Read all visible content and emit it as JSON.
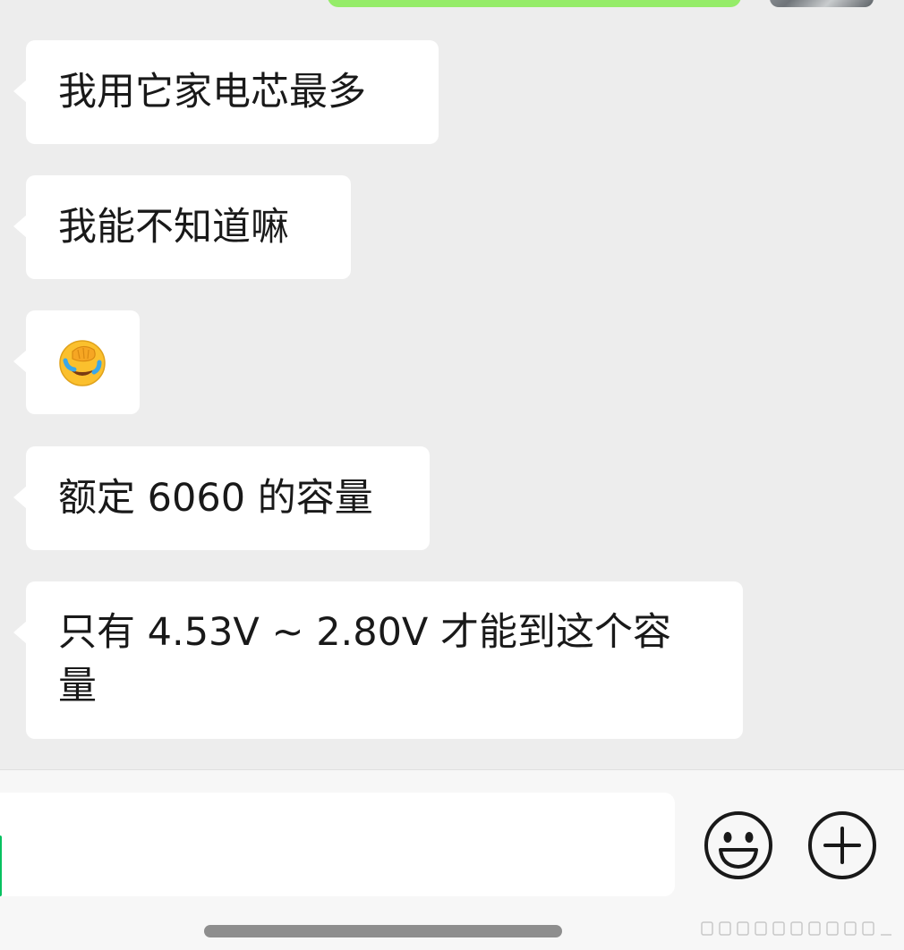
{
  "chat": {
    "messages": [
      {
        "sender": "other",
        "text": "我用它家电芯最多"
      },
      {
        "sender": "other",
        "text": "我能不知道嘛"
      },
      {
        "sender": "other",
        "type": "emoji",
        "icon": "facepalm-crying-emoji"
      },
      {
        "sender": "other",
        "text": "额定 6060 的容量"
      },
      {
        "sender": "other",
        "text": "只有 4.53V ~ 2.80V 才能到这个容\n量"
      }
    ]
  },
  "input": {
    "value": "",
    "placeholder": ""
  },
  "toolbar": {
    "emoji_icon": "smiley-icon",
    "more_icon": "plus-circle-icon"
  },
  "colors": {
    "background": "#ededed",
    "bubble_received": "#ffffff",
    "bubble_sent": "#95ec69",
    "caret": "#07c160",
    "text": "#191919"
  }
}
